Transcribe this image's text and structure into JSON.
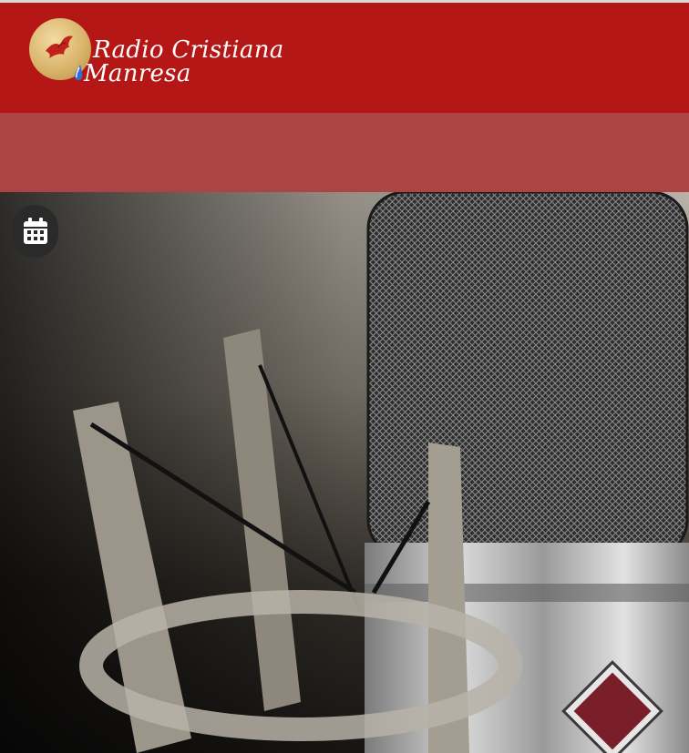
{
  "site": {
    "logo_line1": "Radio Cristiana",
    "logo_line2": "Manresa"
  },
  "colors": {
    "header": "#b51716",
    "nav_band": "#ad4444",
    "logo_gold": "#d9b46b"
  },
  "icons": {
    "calendar": "calendar-icon",
    "logo": "dove-icon"
  }
}
